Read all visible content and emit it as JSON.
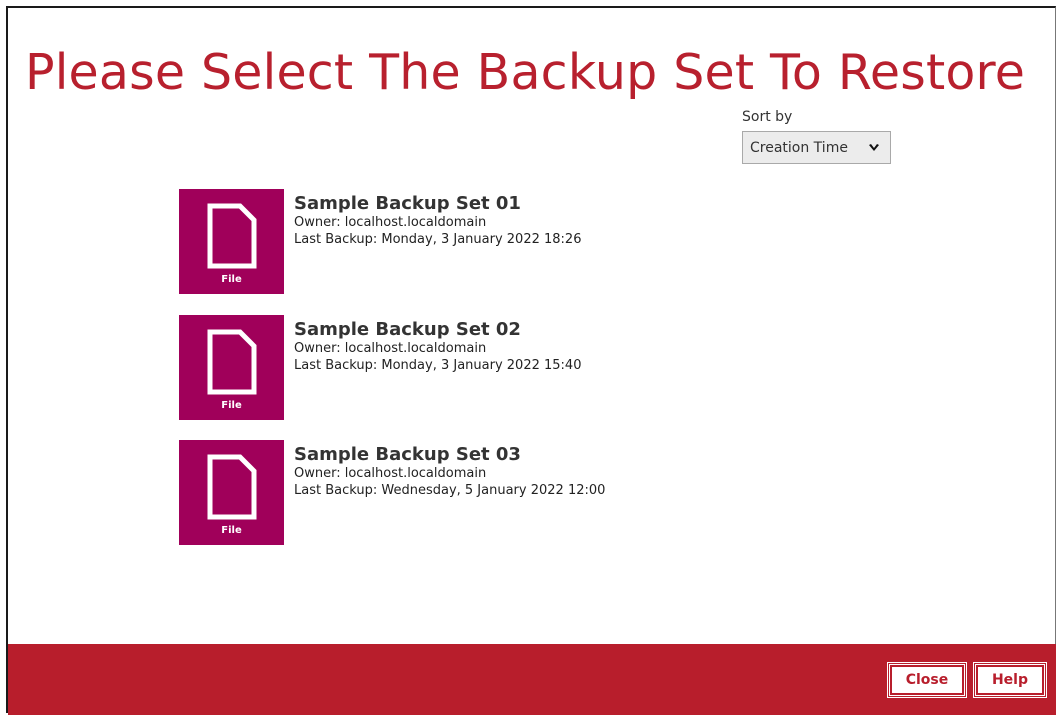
{
  "page": {
    "title": "Please Select The Backup Set To Restore"
  },
  "sort": {
    "label": "Sort by",
    "selected": "Creation Time",
    "icon": "chevron-down-icon"
  },
  "backup_sets": [
    {
      "name": "Sample Backup Set 01",
      "owner": "Owner: localhost.localdomain",
      "last_backup": "Last Backup: Monday, 3 January 2022 18:26",
      "tile_label": "File",
      "icon": "file-icon"
    },
    {
      "name": "Sample Backup Set 02",
      "owner": "Owner: localhost.localdomain",
      "last_backup": "Last Backup: Monday, 3 January 2022 15:40",
      "tile_label": "File",
      "icon": "file-icon"
    },
    {
      "name": "Sample Backup Set 03",
      "owner": "Owner: localhost.localdomain",
      "last_backup": "Last Backup: Wednesday, 5 January 2022 12:00",
      "tile_label": "File",
      "icon": "file-icon"
    }
  ],
  "footer": {
    "close_label": "Close",
    "help_label": "Help"
  },
  "colors": {
    "accent": "#b81e2c",
    "tile": "#a0005a"
  }
}
